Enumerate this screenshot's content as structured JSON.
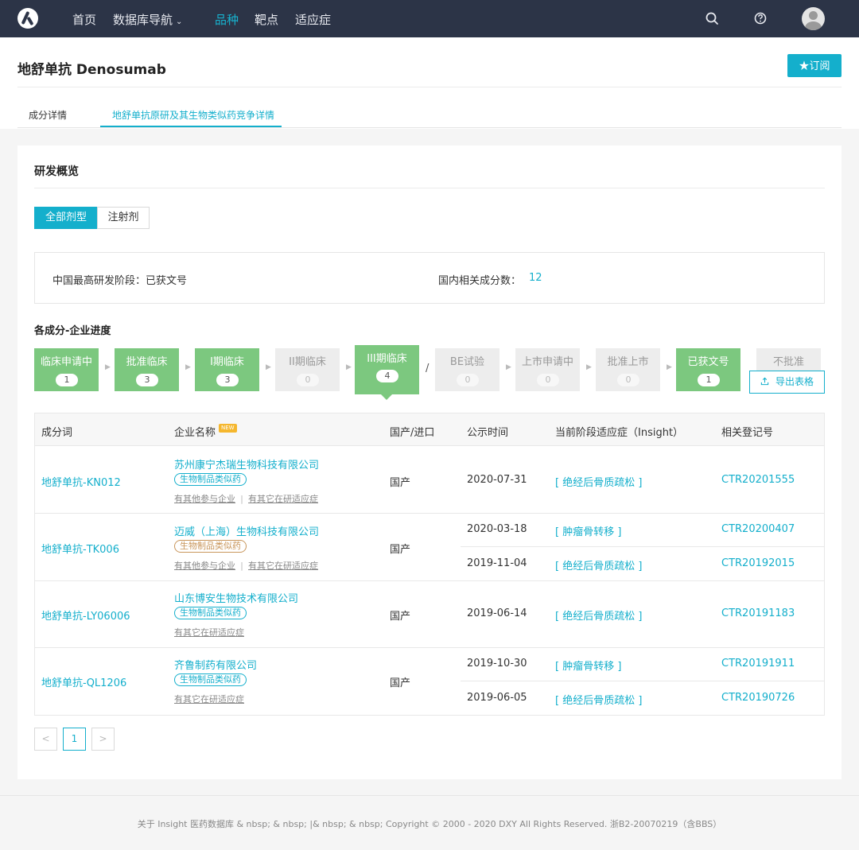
{
  "nav": {
    "items": [
      "首页",
      "数据库导航",
      "品种",
      "靶点",
      "适应症"
    ],
    "accent": "#17b3cf",
    "background": "#2c3447"
  },
  "header": {
    "title": "地舒单抗 Denosumab",
    "subscribe": "★订阅",
    "tabs": [
      "成分详情",
      "地舒单抗原研及其生物类似药竞争详情"
    ]
  },
  "overview": {
    "title": "研发概览",
    "filters": [
      "全部剂型",
      "注射剂"
    ],
    "highest_stage_label": "中国最高研发阶段：",
    "highest_stage_value": "已获文号",
    "count_label": "国内相关成分数：",
    "count_value": "12"
  },
  "progress": {
    "title": "各成分-企业进度",
    "stages": [
      {
        "name": "临床申请中",
        "count": "1",
        "active": true
      },
      {
        "name": "批准临床",
        "count": "3",
        "active": true
      },
      {
        "name": "I期临床",
        "count": "3",
        "active": true
      },
      {
        "name": "II期临床",
        "count": "0",
        "active": false
      },
      {
        "name": "III期临床",
        "count": "4",
        "active": true,
        "selected": true
      },
      {
        "name": "BE试验",
        "count": "0",
        "active": false
      },
      {
        "name": "上市申请中",
        "count": "0",
        "active": false
      },
      {
        "name": "批准上市",
        "count": "0",
        "active": false
      },
      {
        "name": "已获文号",
        "count": "1",
        "active": true
      },
      {
        "name": "不批准",
        "count": "",
        "active": false
      }
    ],
    "slash": "/",
    "export": "导出表格"
  },
  "table": {
    "headers": [
      "成分词",
      "企业名称",
      "国产/进口",
      "公示时间",
      "当前阶段适应症（Insight）",
      "相关登记号"
    ],
    "new_badge": "NEW",
    "rows": [
      {
        "ingredient": "地舒单抗-KN012",
        "company": "苏州康宁杰瑞生物科技有限公司",
        "tag": "生物制品类似药",
        "sublinks": [
          "有其他参与企业",
          "有其它在研适应症"
        ],
        "origin": "国产",
        "entries": [
          {
            "date": "2020-07-31",
            "indication": "[ 绝经后骨质疏松 ]",
            "reg": "CTR20201555"
          }
        ]
      },
      {
        "ingredient": "地舒单抗-TK006",
        "company": "迈威（上海）生物科技有限公司",
        "tag": "生物制品类似药",
        "sublinks": [
          "有其他参与企业",
          "有其它在研适应症"
        ],
        "origin": "国产",
        "entries": [
          {
            "date": "2020-03-18",
            "indication": "[ 肿瘤骨转移 ]",
            "reg": "CTR20200407"
          },
          {
            "date": "2019-11-04",
            "indication": "[ 绝经后骨质疏松 ]",
            "reg": "CTR20192015"
          }
        ]
      },
      {
        "ingredient": "地舒单抗-LY06006",
        "company": "山东博安生物技术有限公司",
        "tag": "生物制品类似药",
        "sublinks": [
          "有其它在研适应症"
        ],
        "origin": "国产",
        "entries": [
          {
            "date": "2019-06-14",
            "indication": "[ 绝经后骨质疏松 ]",
            "reg": "CTR20191183"
          }
        ]
      },
      {
        "ingredient": "地舒单抗-QL1206",
        "company": "齐鲁制药有限公司",
        "tag": "生物制品类似药",
        "sublinks": [
          "有其它在研适应症"
        ],
        "origin": "国产",
        "entries": [
          {
            "date": "2019-10-30",
            "indication": "[ 肿瘤骨转移 ]",
            "reg": "CTR20191911"
          },
          {
            "date": "2019-06-05",
            "indication": "[ 绝经后骨质疏松 ]",
            "reg": "CTR20190726"
          }
        ]
      }
    ]
  },
  "pagination": {
    "prev": "<",
    "current": "1",
    "next": ">"
  },
  "footer": {
    "text": "关于 Insight 医药数据库 & nbsp; & nbsp; |& nbsp; & nbsp; Copyright © 2000 - 2020 DXY All Rights Reserved. 浙B2-20070219（含BBS）"
  }
}
